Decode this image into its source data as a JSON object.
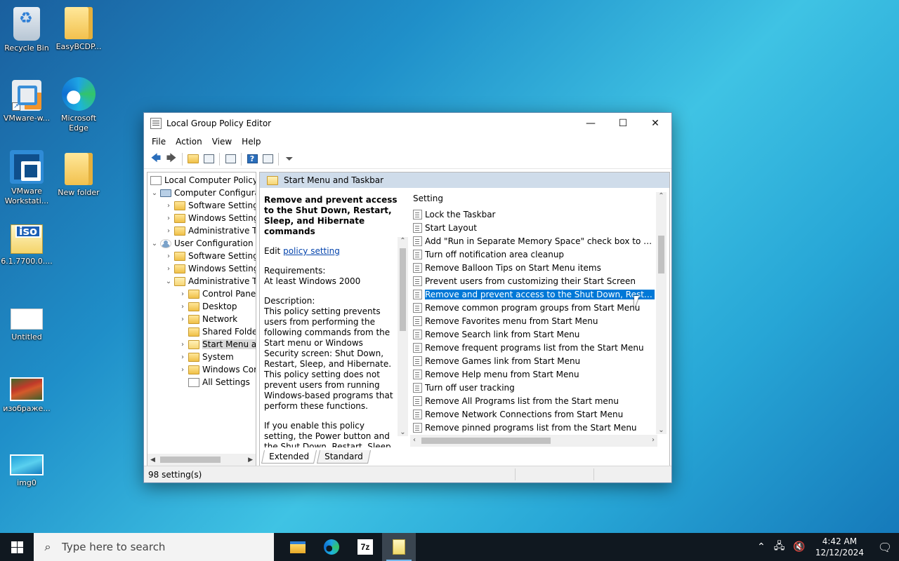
{
  "desktop": {
    "icons": [
      {
        "label": "Recycle Bin"
      },
      {
        "label": "EasyBCDP..."
      },
      {
        "label": "VMware-w..."
      },
      {
        "label": "Microsoft Edge"
      },
      {
        "label": "VMware Workstati..."
      },
      {
        "label": "New folder"
      },
      {
        "label": "6.1.7700.0...."
      },
      {
        "label": "Untitled"
      },
      {
        "label": "изображе..."
      },
      {
        "label": "img0"
      }
    ]
  },
  "window": {
    "title": "Local Group Policy Editor",
    "controls": {
      "minimize": "—",
      "maximize": "☐",
      "close": "✕"
    },
    "menu": [
      "File",
      "Action",
      "View",
      "Help"
    ],
    "tree": [
      {
        "label": "Local Computer Policy"
      },
      {
        "label": "Computer Configura"
      },
      {
        "label": "Software Settings"
      },
      {
        "label": "Windows Setting"
      },
      {
        "label": "Administrative Te"
      },
      {
        "label": "User Configuration"
      },
      {
        "label": "Software Settings"
      },
      {
        "label": "Windows Setting"
      },
      {
        "label": "Administrative Te"
      },
      {
        "label": "Control Panel"
      },
      {
        "label": "Desktop"
      },
      {
        "label": "Network"
      },
      {
        "label": "Shared Folder"
      },
      {
        "label": "Start Menu ar"
      },
      {
        "label": "System"
      },
      {
        "label": "Windows Cor"
      },
      {
        "label": "All Settings"
      }
    ],
    "section_title": "Start Menu and Taskbar",
    "extended": {
      "policy_title": "Remove and prevent access to the Shut Down, Restart, Sleep, and Hibernate commands",
      "edit_prefix": "Edit",
      "edit_link": "policy setting",
      "requirements_label": "Requirements:",
      "requirements_value": "At least Windows 2000",
      "description_label": "Description:",
      "description": "This policy setting prevents users from performing the following commands from the Start menu or Windows Security screen: Shut Down, Restart, Sleep, and Hibernate. This policy setting does not prevent users from running Windows-based programs that perform these functions.",
      "description2": "If you enable this policy setting, the Power button and the Shut Down, Restart, Sleep, and Hibernate commands are"
    },
    "list": {
      "header": "Setting",
      "items": [
        "Lock the Taskbar",
        "Start Layout",
        "Add \"Run in Separate Memory Space\" check box to Run dial...",
        "Turn off notification area cleanup",
        "Remove Balloon Tips on Start Menu items",
        "Prevent users from customizing their Start Screen",
        "Remove and prevent access to the Shut Down, Restart, Sleep...",
        "Remove common program groups from Start Menu",
        "Remove Favorites menu from Start Menu",
        "Remove Search link from Start Menu",
        "Remove frequent programs list from the Start Menu",
        "Remove Games link from Start Menu",
        "Remove Help menu from Start Menu",
        "Turn off user tracking",
        "Remove All Programs list from the Start menu",
        "Remove Network Connections from Start Menu",
        "Remove pinned programs list from the Start Menu"
      ],
      "selected_index": 6
    },
    "tabs": [
      "Extended",
      "Standard"
    ],
    "status": "98 setting(s)"
  },
  "taskbar": {
    "search_placeholder": "Type here to search",
    "time": "4:42 AM",
    "date": "12/12/2024"
  }
}
